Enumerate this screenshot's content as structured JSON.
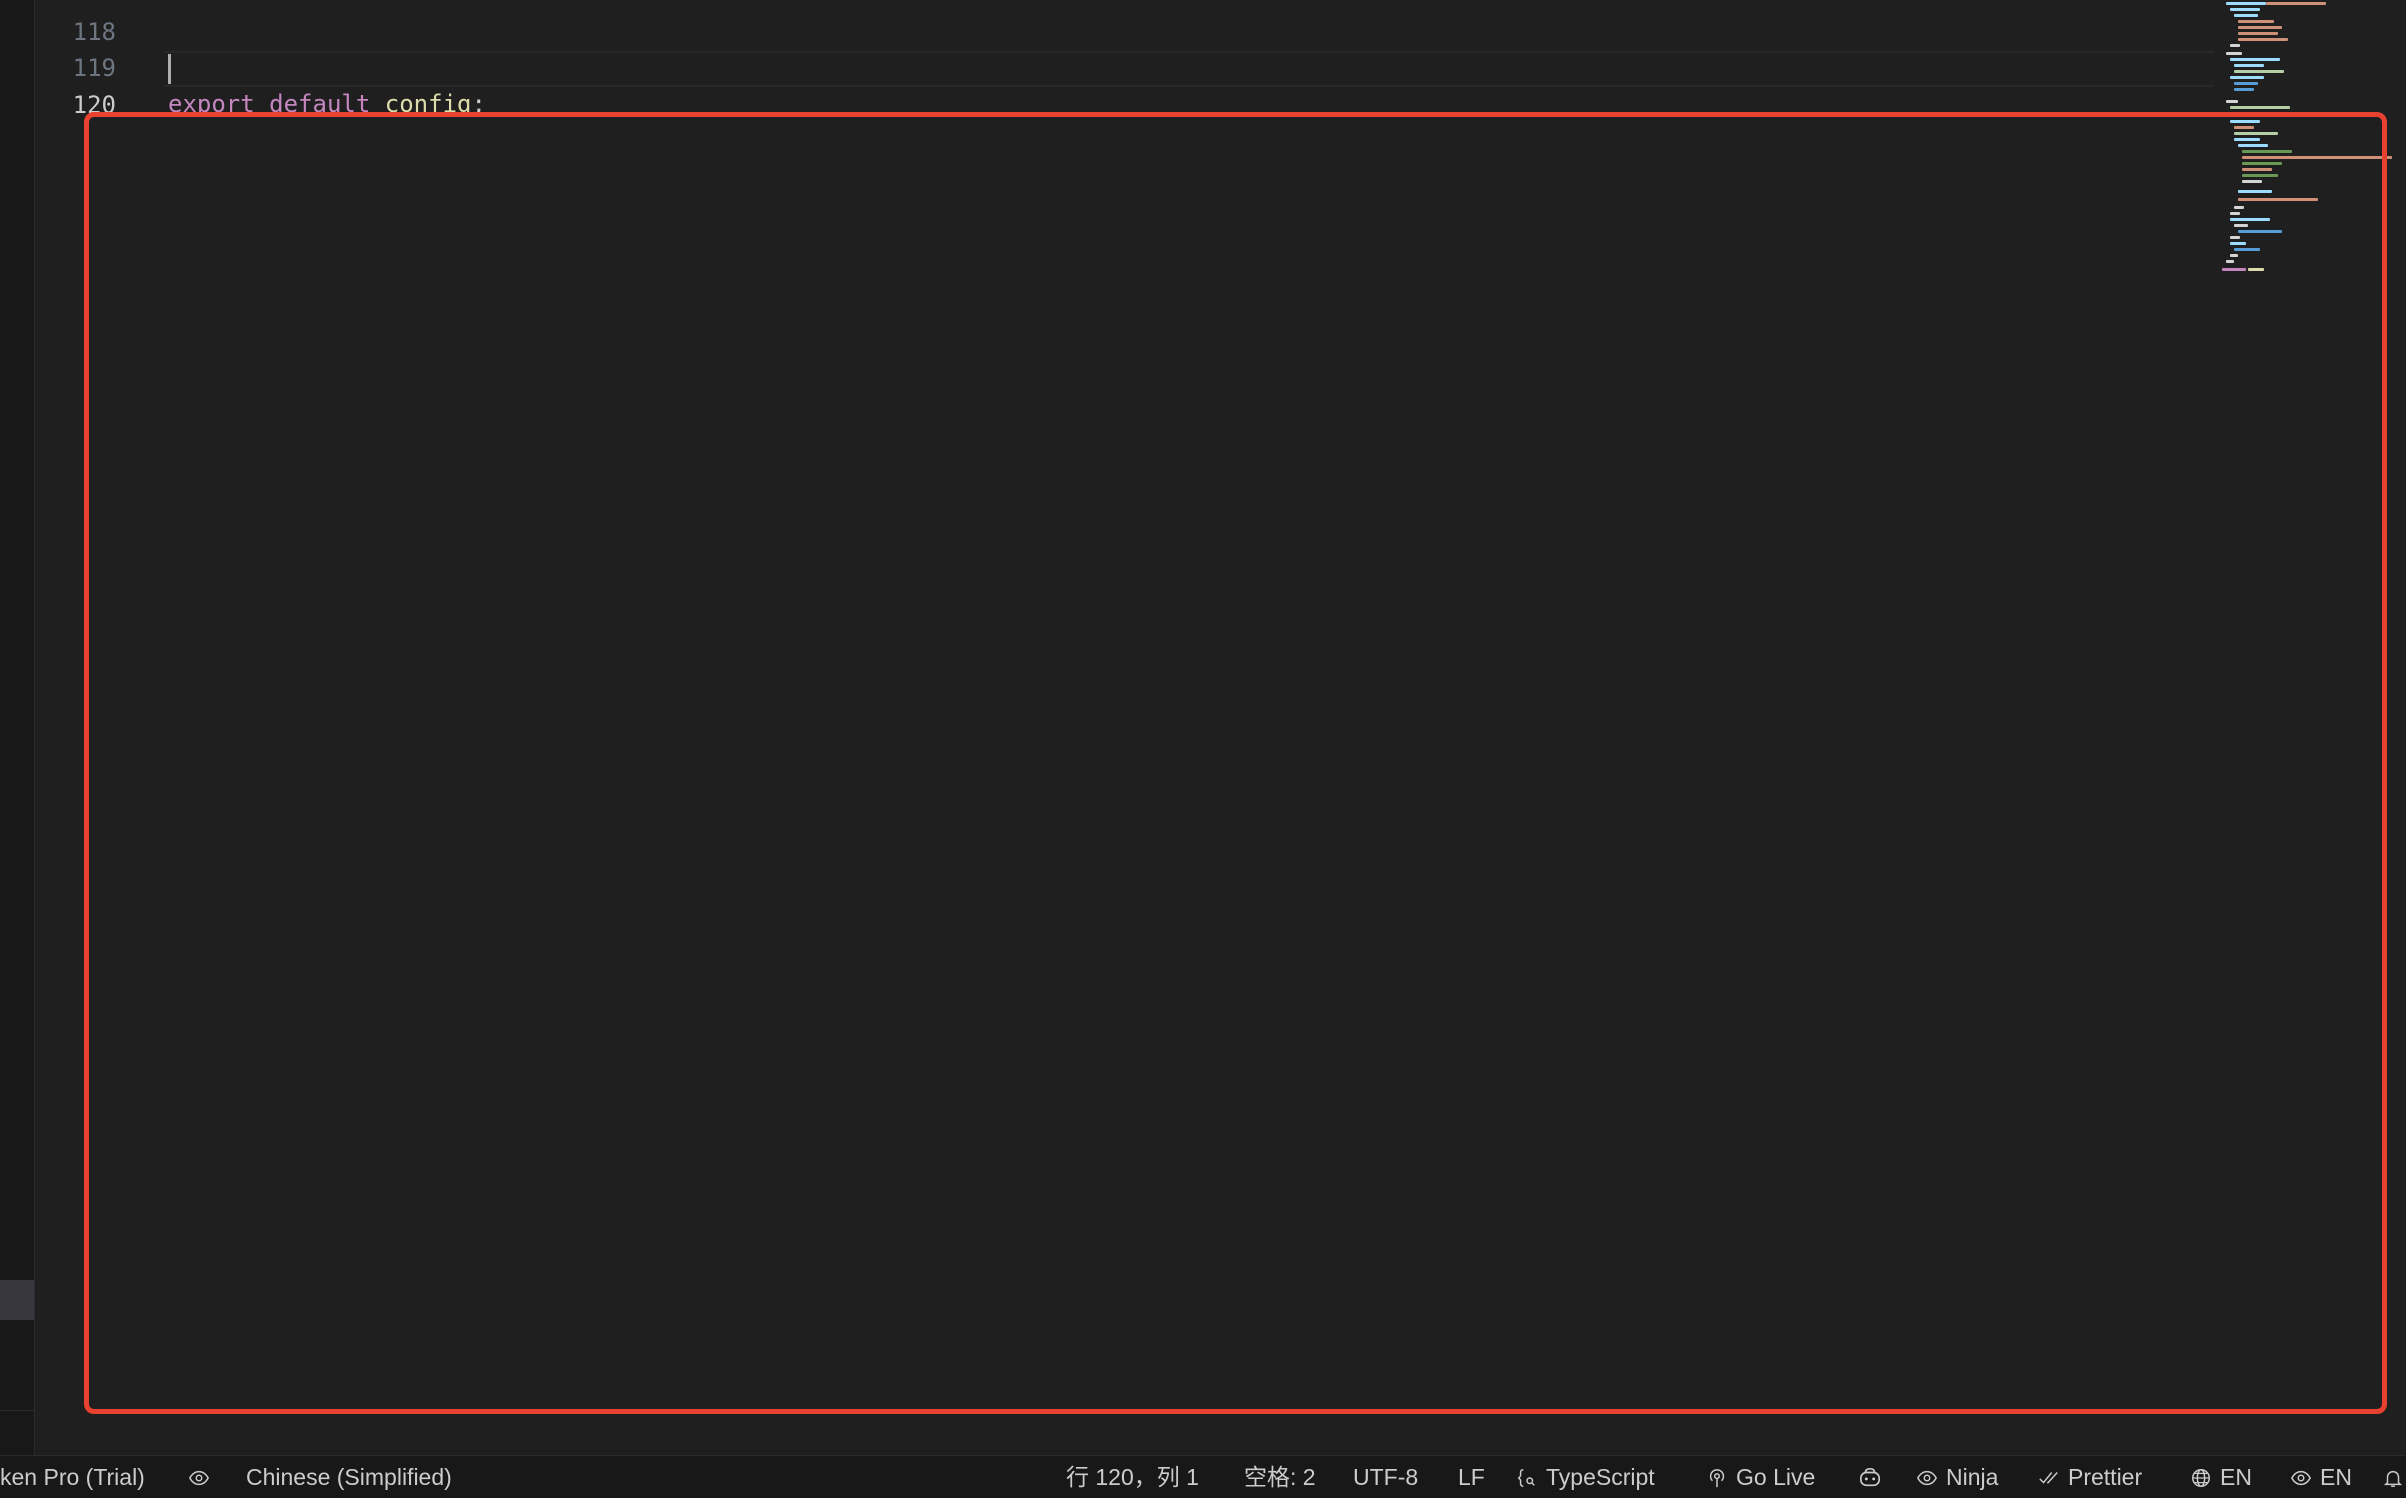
{
  "editor": {
    "lines": [
      {
        "number": "118",
        "partial": true
      },
      {
        "number": "119",
        "tokens": {
          "kw1": "export",
          "kw2": "default",
          "ident": "config",
          "punct": ";"
        }
      },
      {
        "number": "120",
        "active": true
      }
    ]
  },
  "statusbar": {
    "left_item": "ken Pro (Trial)",
    "language_pack": "Chinese (Simplified)",
    "cursor_position": "行 120，列 1",
    "indentation": "空格: 2",
    "encoding": "UTF-8",
    "eol": "LF",
    "language_mode": "TypeScript",
    "go_live": "Go Live",
    "ninja": "Ninja",
    "prettier": "Prettier",
    "lang_en_1": "EN",
    "lang_en_2": "EN"
  },
  "colors": {
    "highlight_border": "#e8412f",
    "keyword": "#c586c0",
    "identifier": "#dcdcaa",
    "background": "#1f1f1f"
  }
}
